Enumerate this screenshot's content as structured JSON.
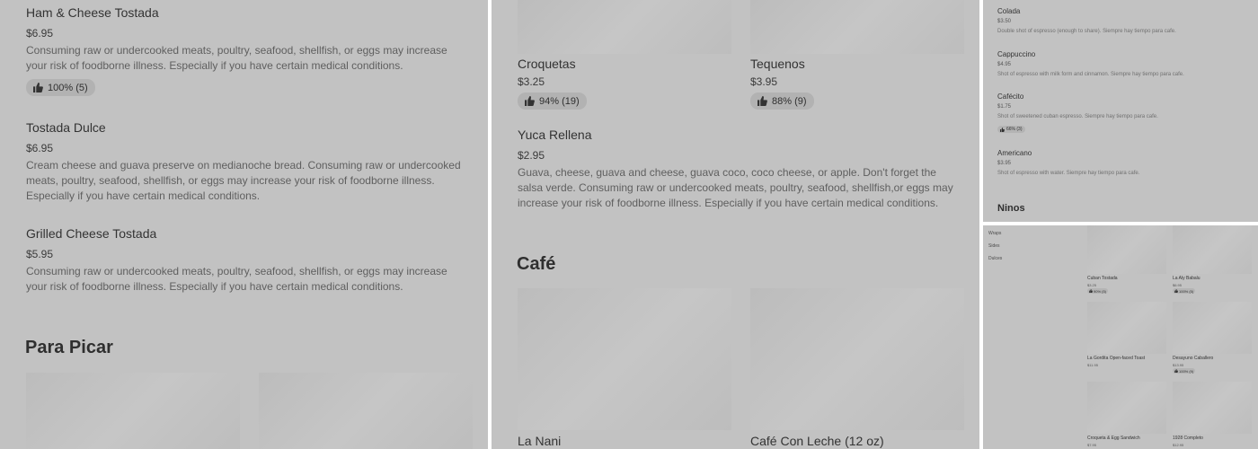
{
  "left": {
    "items": [
      {
        "name": "Ham & Cheese Tostada",
        "price": "$6.95",
        "desc": [
          "Consuming raw or undercooked meats, poultry, seafood, shellfish, or eggs may increase",
          "your risk of foodborne illness. Especially if you have certain medical conditions."
        ],
        "rating": "100% (5)"
      },
      {
        "name": "Tostada Dulce",
        "price": "$6.95",
        "desc": [
          "Cream cheese and guava preserve on medianoche bread. Consuming raw or undercooked",
          "meats, poultry, seafood, shellfish, or eggs may increase your risk of foodborne illness.",
          "Especially if you have certain medical conditions."
        ]
      },
      {
        "name": "Grilled Cheese Tostada",
        "price": "$5.95",
        "desc": [
          "Consuming raw or undercooked meats, poultry, seafood, shellfish, or eggs may increase",
          "your risk of foodborne illness. Especially if you have certain medical conditions."
        ]
      }
    ],
    "section_title": "Para Picar"
  },
  "middle": {
    "top_items": [
      {
        "name": "Croquetas",
        "price": "$3.25",
        "rating": "94% (19)"
      },
      {
        "name": "Tequenos",
        "price": "$3.95",
        "rating": "88% (9)"
      }
    ],
    "yuca": {
      "name": "Yuca Rellena",
      "price": "$2.95",
      "desc": [
        "Guava, cheese, guava and cheese, guava coco, coco cheese, or apple. Don't forget the",
        "salsa verde. Consuming raw or undercooked meats, poultry, seafood, shellfish,or eggs may",
        "increase your risk of foodborne illness. Especially if you have certain medical conditions."
      ]
    },
    "section_title": "Café",
    "bottom_items": [
      {
        "name": "La Nani"
      },
      {
        "name": "Café Con Leche (12 oz)"
      }
    ]
  },
  "top_right": {
    "items": [
      {
        "name": "Colada",
        "price": "$3.50",
        "desc": "Double shot of espresso (enough to share). Siempre hay tiempo para cafe."
      },
      {
        "name": "Cappuccino",
        "price": "$4.95",
        "desc": "Shot of espresso with milk form and cinnamon. Siempre hay tiempo para cafe."
      },
      {
        "name": "Cafécito",
        "price": "$1.75",
        "desc": "Shot of sweetened cuban espresso. Siempre hay tiempo para cafe.",
        "rating": "66% (3)"
      },
      {
        "name": "Americano",
        "price": "$3.95",
        "desc": "Shot of espresso with water. Siempre hay tiempo para cafe."
      }
    ],
    "section_title": "Ninos"
  },
  "bottom_right": {
    "nav": [
      "Wraps",
      "Sides",
      "Dulces"
    ],
    "items": [
      {
        "name": "Cuban Tostada",
        "price": "$3.25",
        "rating": "90% (5)"
      },
      {
        "name": "La Aly Babalu",
        "price": "$6.95",
        "rating": "100% (5)"
      },
      {
        "name": "La Gordita Open-faced Toast",
        "price": "$11.95"
      },
      {
        "name": "Desayuno Caballero",
        "price": "$13.95",
        "rating": "100% (9)"
      },
      {
        "name": "Croqueta & Egg Sandwich",
        "price": "$7.95"
      },
      {
        "name": "1928 Completo",
        "price": "$12.95"
      }
    ]
  },
  "icons": {
    "rating": "thumbs-up-icon"
  }
}
